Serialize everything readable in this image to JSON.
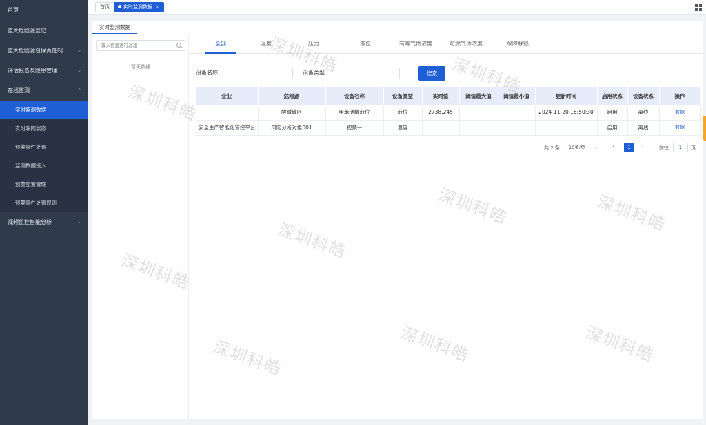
{
  "sidebar": {
    "items": [
      {
        "label": "首页"
      },
      {
        "label": "重大危险源登记"
      },
      {
        "label": "重大危险源包保责任制"
      },
      {
        "label": "评估报告及隐患管理"
      },
      {
        "label": "在线监测"
      },
      {
        "label": "视频监控智能分析"
      }
    ],
    "sub_items": [
      {
        "label": "实时监测数据"
      },
      {
        "label": "实时联网状态"
      },
      {
        "label": "预警事件处置"
      },
      {
        "label": "监测数据接入"
      },
      {
        "label": "预警配置管理"
      },
      {
        "label": "预警事件处置规则"
      }
    ]
  },
  "tabs": {
    "home": "首页",
    "active": "实时监测数据",
    "close": "×"
  },
  "panel": {
    "title": "实时监测数据"
  },
  "filter": {
    "placeholder": "输入信息进行过滤",
    "empty": "暂无数据"
  },
  "subtabs": [
    "全部",
    "温度",
    "压力",
    "液位",
    "有毒气体浓度",
    "可燃气体浓度",
    "故障联锁"
  ],
  "search": {
    "device_name_label": "设备名称",
    "device_type_label": "设备类型",
    "button": "搜索"
  },
  "table": {
    "headers": [
      "企业",
      "危险源",
      "设备名称",
      "设备类型",
      "实时值",
      "阈值最大值",
      "阈值最小值",
      "更新时间",
      "启用状态",
      "设备状态",
      "操作"
    ],
    "rows": [
      [
        "",
        "酸碱罐区",
        "甲苯储罐液位",
        "液位",
        "2738.245",
        "",
        "",
        "2024-11-20 16:50:30",
        "启用",
        "离线",
        "数据"
      ],
      [
        "安全生产智能化管控平台",
        "风险分析对象001",
        "视频一",
        "温度",
        "",
        "",
        "",
        "",
        "启用",
        "离线",
        "数据"
      ]
    ]
  },
  "pager": {
    "total": "共 2 条",
    "size": "10条/页",
    "prev": "‹",
    "current": "1",
    "next": "›",
    "goto": "前往",
    "jump": "1",
    "page": "页"
  },
  "watermark": "深圳科皓"
}
